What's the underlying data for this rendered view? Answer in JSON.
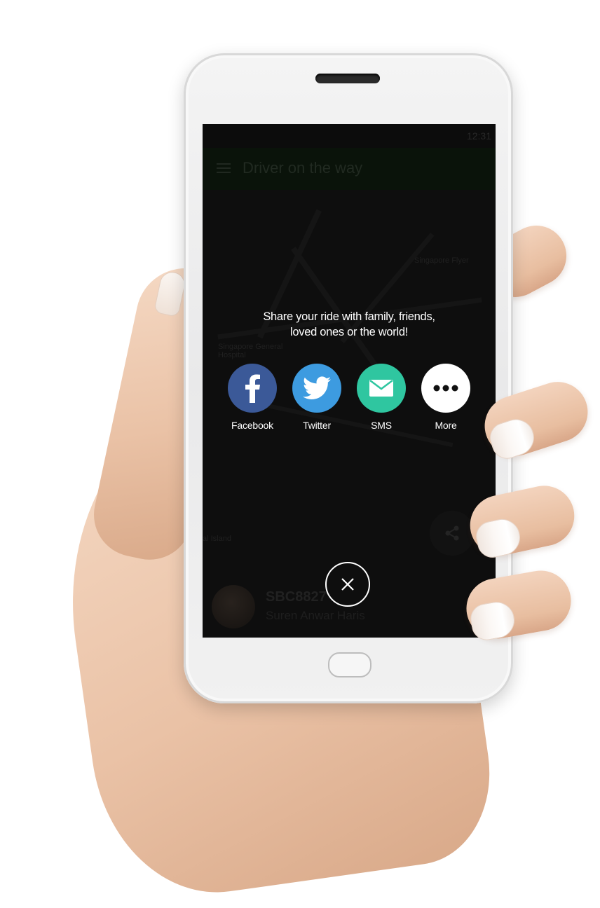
{
  "status_bar": {
    "time": "12:31"
  },
  "app_bar": {
    "title": "Driver on the way",
    "menu_icon": "menu-icon"
  },
  "map": {
    "labels": [
      "Singapore Flyer",
      "Singapore General Hospital",
      "al Island"
    ]
  },
  "driver_card": {
    "plate": "SBC8827",
    "driver_name": "Suren Anwar Haris"
  },
  "share_sheet": {
    "heading_line1": "Share your ride with family, friends,",
    "heading_line2": "loved ones or the world!",
    "options": [
      {
        "label": "Facebook",
        "icon": "facebook-icon",
        "color": "#3b5998"
      },
      {
        "label": "Twitter",
        "icon": "twitter-icon",
        "color": "#3d9be0"
      },
      {
        "label": "SMS",
        "icon": "envelope-icon",
        "color": "#2fc6a0"
      },
      {
        "label": "More",
        "icon": "more-icon",
        "color": "#ffffff"
      }
    ],
    "close_icon": "close-icon"
  }
}
